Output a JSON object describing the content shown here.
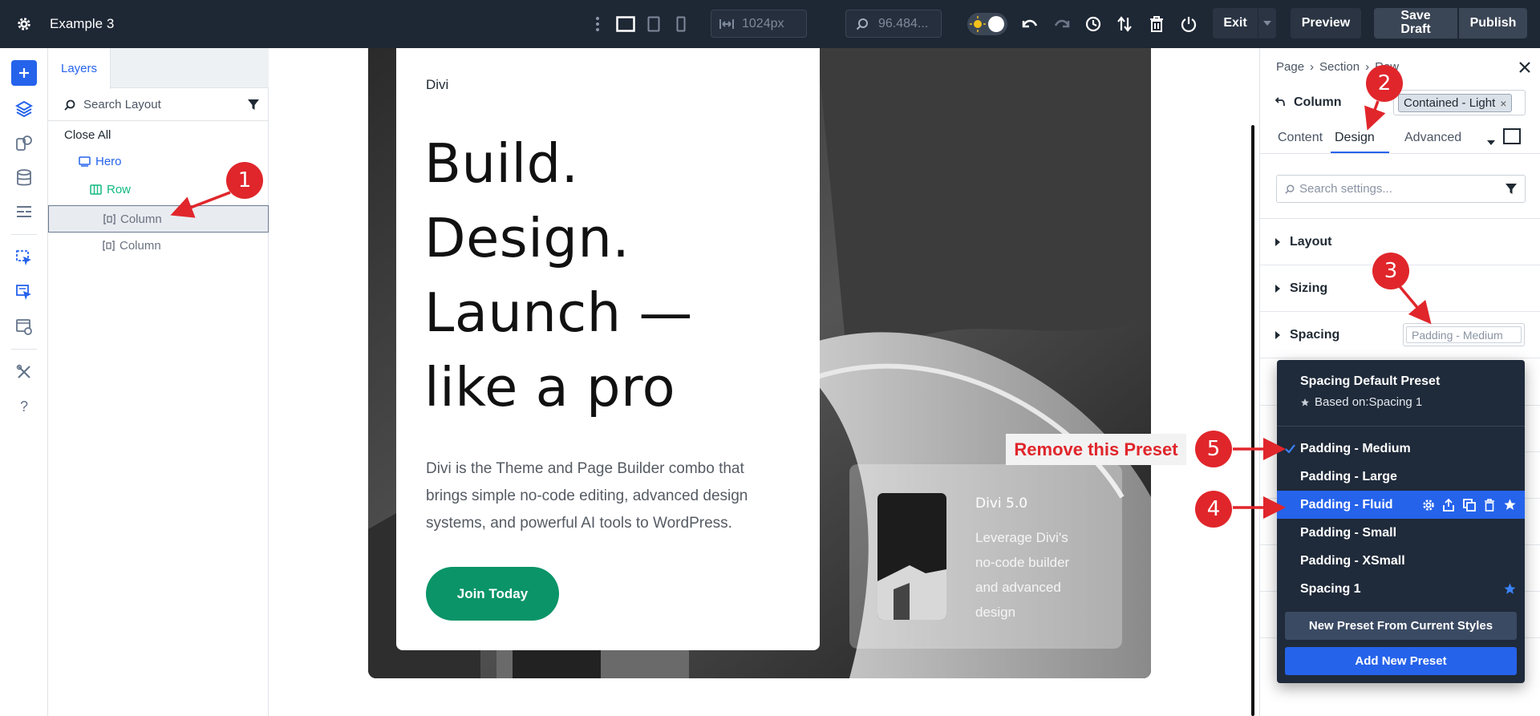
{
  "topbar": {
    "title": "Example 3",
    "width_value": "1024px",
    "zoom_value": "96.484...",
    "exit_label": "Exit",
    "preview_label": "Preview",
    "save_draft_label": "Save Draft",
    "publish_label": "Publish"
  },
  "layers": {
    "tab_label": "Layers",
    "search_placeholder": "Search Layout",
    "close_all": "Close All",
    "items": [
      {
        "label": "Hero",
        "color": "#2563eb"
      },
      {
        "label": "Row",
        "color": "#10b981"
      },
      {
        "label": "Column",
        "color": "#6b7280"
      },
      {
        "label": "Column",
        "color": "#6b7280"
      }
    ]
  },
  "canvas": {
    "logo_text": "Divi",
    "headline": [
      "Build.",
      "Design.",
      "Launch —",
      "like a pro"
    ],
    "body_lines": [
      "Divi is the Theme and Page Builder combo that",
      "brings simple no-code editing, advanced design",
      "systems, and powerful AI tools to WordPress."
    ],
    "cta_label": "Join Today",
    "cta_color": "#0a9467",
    "promo_title": "Divi 5.0",
    "promo_lines": [
      "Leverage Divi's",
      "no-code builder",
      "and advanced",
      "design"
    ]
  },
  "settings": {
    "breadcrumb": [
      "Page",
      "Section",
      "Row"
    ],
    "element_label": "Column",
    "preset_chip": "Contained - Light",
    "tabs": [
      "Content",
      "Design",
      "Advanced"
    ],
    "active_tab": "Design",
    "search_placeholder": "Search settings...",
    "sections": [
      "Layout",
      "Sizing",
      "Spacing"
    ],
    "spacing_preset": "Padding - Medium",
    "accent": "#2563eb"
  },
  "dropdown": {
    "default_title": "Spacing Default Preset",
    "default_based": "Based on:Spacing 1",
    "items": [
      "Padding - Medium",
      "Padding - Large",
      "Padding - Fluid",
      "Padding - Small",
      "Padding - XSmall",
      "Spacing 1"
    ],
    "checked_item": "Padding - Medium",
    "highlighted_item": "Padding - Fluid",
    "new_preset_label": "New Preset From Current Styles",
    "add_preset_label": "Add New Preset"
  },
  "annotations": {
    "badges": [
      "1",
      "2",
      "3",
      "4",
      "5"
    ],
    "remove_label": "Remove this Preset",
    "color": "#e0262b"
  }
}
